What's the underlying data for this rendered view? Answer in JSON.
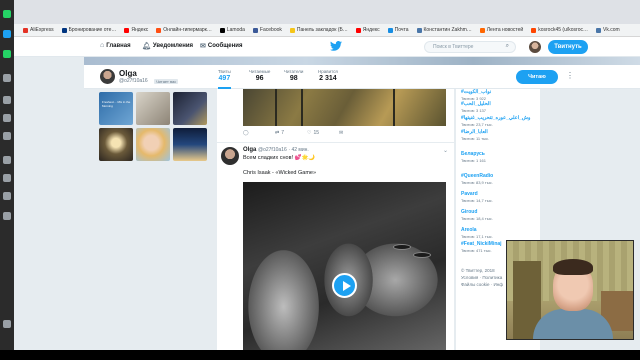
{
  "colors": {
    "twitter_blue": "#1da1f2",
    "text_primary": "#14171a",
    "text_secondary": "#657786",
    "page_bg": "#e6ecf0"
  },
  "bookmarks": [
    {
      "label": "AliExpress",
      "color": "#e43225"
    },
    {
      "label": "Бронирование оте…",
      "color": "#003580"
    },
    {
      "label": "Яндекс",
      "color": "#ff0000"
    },
    {
      "label": "Онлайн-гипермарк…",
      "color": "#ff4f12"
    },
    {
      "label": "Lamoda",
      "color": "#000000"
    },
    {
      "label": "Facebook",
      "color": "#3b5998"
    },
    {
      "label": "Панель закладок (Б…",
      "color": "#f5c518"
    },
    {
      "label": "Яндекс",
      "color": "#ff0000"
    },
    {
      "label": "Почта",
      "color": "#168de2"
    },
    {
      "label": "Константин Zakhm…",
      "color": "#4a76a8"
    },
    {
      "label": "Лента новостей",
      "color": "#ff6600"
    },
    {
      "label": "kosrock45 (u/kosroc…",
      "color": "#ff4500"
    },
    {
      "label": "Vk.com",
      "color": "#4a76a8"
    }
  ],
  "nav": {
    "home": "Главная",
    "notifications": "Уведомления",
    "messages": "Сообщения",
    "search_placeholder": "Поиск в Твиттере",
    "tweet_button": "Твитнуть"
  },
  "profile": {
    "name": "Olga",
    "handle": "@o27f10a16",
    "follows_you": "Читает вас",
    "read_button": "Читаю",
    "stats": [
      {
        "label": "Твиты",
        "value": "497"
      },
      {
        "label": "Читаемые",
        "value": "96"
      },
      {
        "label": "Читатели",
        "value": "98"
      },
      {
        "label": "Нравится",
        "value": "2 314"
      }
    ]
  },
  "media_thumbs": [
    {
      "caption": "Freshest… Mix in the Morning"
    },
    {
      "caption": ""
    },
    {
      "caption": ""
    },
    {
      "caption": ""
    },
    {
      "caption": ""
    },
    {
      "caption": ""
    }
  ],
  "prev_tweet_actions": {
    "retweets": "7",
    "likes": "15"
  },
  "tweet": {
    "name": "Olga",
    "handle": "@o27f10a16",
    "time": "· 42 мин.",
    "text": "Всем сладких снов! 💕🌟🌙",
    "song": "Chris Isaak - «Wicked Game»"
  },
  "trends": [
    {
      "name": "#نواب_الكويت",
      "count": "Твитов: 3 922"
    },
    {
      "name": "#الحليل_الحب",
      "count": "Твитов: 3 137"
    },
    {
      "name": "#وش_اعلي_عوره_تتحريب_غنيتها",
      "count": "Твитов: 23,7 тыс."
    },
    {
      "name": "#العابا_الرضا",
      "count": "Твитов: 11 тыс."
    },
    {
      "name": "Беларусь",
      "count": "Твитов: 1 161"
    },
    {
      "name": "#QueenRadio",
      "count": "Твитов: 83,9 тыс."
    },
    {
      "name": "Pavard",
      "count": "Твитов: 14,7 тыс."
    },
    {
      "name": "Giroud",
      "count": "Твитов: 18,4 тыс."
    },
    {
      "name": "Areola",
      "count": "Твитов: 17,1 тыс."
    },
    {
      "name": "#Feat_NickiMinaj",
      "count": "Твитов: 471 тыс."
    }
  ],
  "footer": {
    "line1": "© Твиттер, 2018",
    "line2": "Условия · Политика",
    "line3": "Файлы cookie · Инф"
  }
}
